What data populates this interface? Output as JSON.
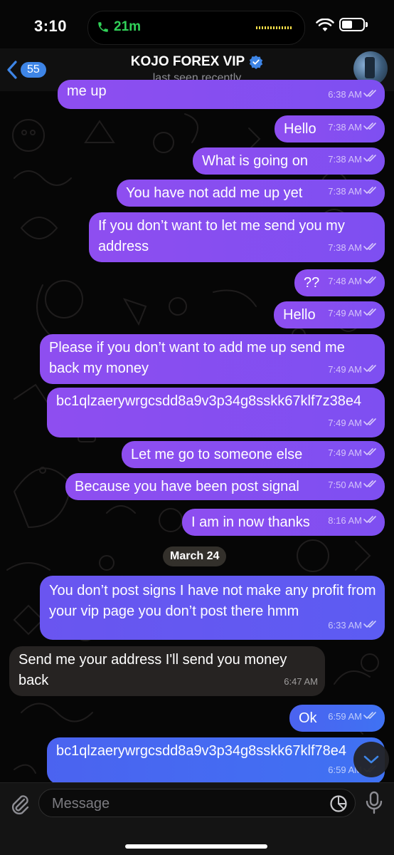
{
  "status_bar": {
    "time": "3:10",
    "call_duration": "21m"
  },
  "header": {
    "back_count": "55",
    "title": "KOJO FOREX VIP",
    "subtitle": "last seen recently"
  },
  "messages": [
    {
      "text": "me up",
      "time": "6:38 AM",
      "dir": "out"
    },
    {
      "text": "Hello",
      "time": "7:38 AM",
      "dir": "out"
    },
    {
      "text": "What is going on",
      "time": "7:38 AM",
      "dir": "out"
    },
    {
      "text": "You have not add me up yet",
      "time": "7:38 AM",
      "dir": "out"
    },
    {
      "text": "If you don’t want to let me send you my address",
      "time": "7:38 AM",
      "dir": "out"
    },
    {
      "text": "??",
      "time": "7:48 AM",
      "dir": "out"
    },
    {
      "text": "Hello",
      "time": "7:49 AM",
      "dir": "out"
    },
    {
      "text": "Please if you don’t want to add me up send me back my money",
      "time": "7:49 AM",
      "dir": "out"
    },
    {
      "text": "bc1qlzaerywrgcsdd8a9v3p34g8sskk67klf7z38e4",
      "time": "7:49 AM",
      "dir": "out"
    },
    {
      "text": "Let me go to someone else",
      "time": "7:49 AM",
      "dir": "out"
    },
    {
      "text": "Because you have been post signal",
      "time": "7:50 AM",
      "dir": "out"
    },
    {
      "text": "I am in now thanks",
      "time": "8:16 AM",
      "dir": "out"
    },
    {
      "text": "You don’t post signs I have not make any profit from your vip page you don’t post there hmm",
      "time": "6:33 AM",
      "dir": "out"
    },
    {
      "text": "Send me your address I'll send you money back",
      "time": "6:47 AM",
      "dir": "in"
    },
    {
      "text": "Ok",
      "time": "6:59 AM",
      "dir": "out"
    },
    {
      "text": "bc1qlzaerywrgcsdd8a9v3p34g8sskk67klf78e4",
      "time": "6:59 AM",
      "dir": "out"
    }
  ],
  "date_separator": "March 24",
  "composer": {
    "placeholder": "Message"
  },
  "colors": {
    "accent": "#3e85e6",
    "outgoing_purple": "#8e4ef0",
    "outgoing_blue": "#3f72f3",
    "incoming": "#262322",
    "call_green": "#31d158"
  },
  "icons": [
    "phone-icon",
    "wifi-icon",
    "battery-icon",
    "back-chevron-icon",
    "verified-icon",
    "read-check-icon",
    "chevron-down-icon",
    "paperclip-icon",
    "sticker-icon",
    "microphone-icon"
  ]
}
